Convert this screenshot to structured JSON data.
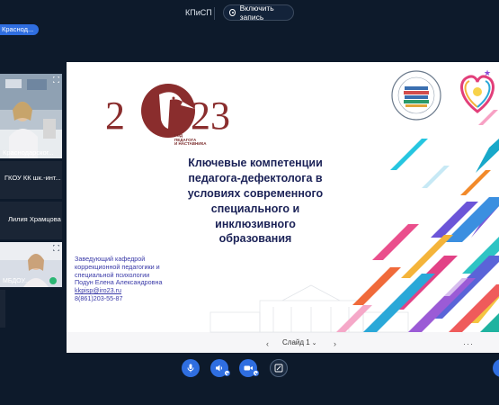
{
  "header": {
    "meeting_title": "КПиСП",
    "record_button": "Включить запись"
  },
  "location_chip": "Краснод...",
  "participants": [
    {
      "label": "Краснодарског..."
    },
    {
      "label": "ГКОУ КК шк.-инт..."
    },
    {
      "label": "Лилия Храмцова"
    },
    {
      "label": "МБДОУ..."
    }
  ],
  "slide": {
    "title_lines": [
      "Ключевые компетенции",
      "педагога-дефектолога в",
      "условиях современного",
      "специального и",
      "инклюзивного",
      "образования"
    ],
    "contact_lines": [
      "Заведующий кафедрой",
      "коррекционной педагогики и",
      "специальной психологии",
      "Подун Елена Александровна",
      "kkpisp@iro23.ru",
      "8(861)203-55-87"
    ],
    "logo_year": "2023",
    "logo_caption": [
      "ГОД",
      "ПЕДАГОГА",
      "И НАСТАВНИКА"
    ],
    "slide_selector": "Слайд 1"
  },
  "colors": {
    "accent": "#2f6ee0",
    "background": "#0d1a2b",
    "title": "#1b2257",
    "contact": "#3a3aa8",
    "logo": "#7a2a2a"
  },
  "controls": {
    "microphone": "microphone-icon",
    "speaker": "speaker-icon",
    "camera": "camera-icon",
    "screen_share": "screen-share-icon"
  }
}
